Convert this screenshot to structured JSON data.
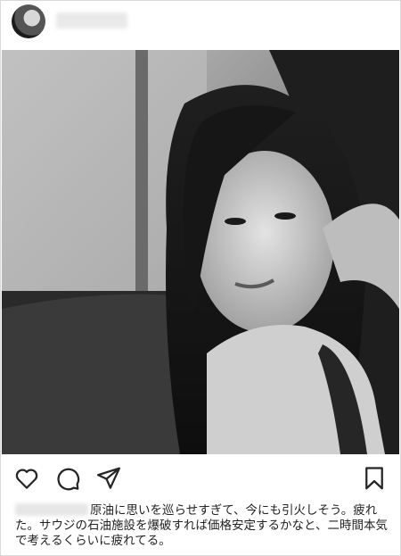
{
  "header": {
    "avatar_icon": "profile-avatar",
    "more_icon": "more-options-icon"
  },
  "post": {
    "photo_description_icon": "portrait-photo"
  },
  "actions": {
    "like_icon": "heart-icon",
    "comment_icon": "comment-icon",
    "share_icon": "paper-plane-icon",
    "save_icon": "bookmark-icon"
  },
  "caption": {
    "text": "原油に思いを巡らせすぎて、今にも引火しそう。疲れた。サウジの石油施設を爆破すれば価格安定するかなと、二時間本気で考えるくらいに疲れてる。"
  }
}
